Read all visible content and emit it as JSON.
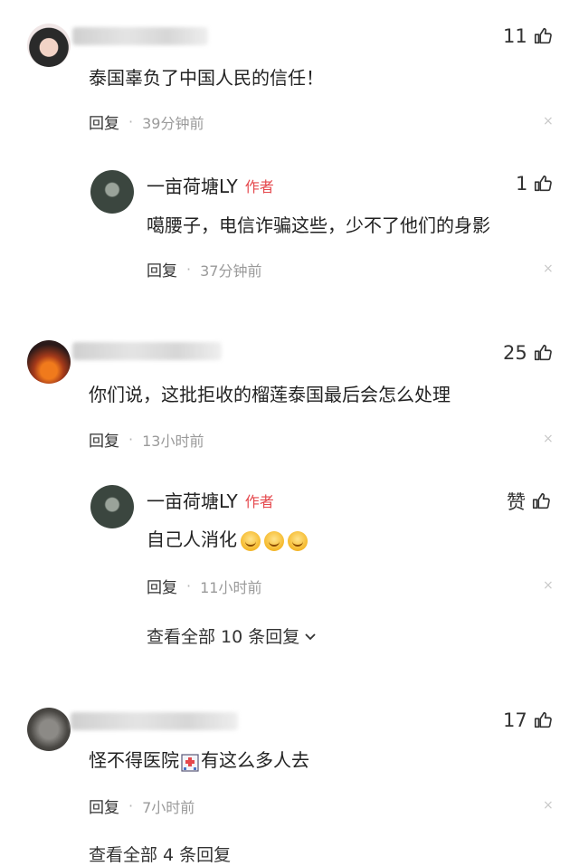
{
  "comments": [
    {
      "likes": "11",
      "text": "泰国辜负了中国人民的信任！",
      "reply_label": "回复",
      "time": "39分钟前",
      "replies": [
        {
          "name": "一亩荷塘LY",
          "tag": "作者",
          "likes": "1",
          "text": "噶腰子，电信诈骗这些，少不了他们的身影",
          "reply_label": "回复",
          "time": "37分钟前"
        }
      ]
    },
    {
      "likes": "25",
      "text": "你们说，这批拒收的榴莲泰国最后会怎么处理",
      "reply_label": "回复",
      "time": "13小时前",
      "replies": [
        {
          "name": "一亩荷塘LY",
          "tag": "作者",
          "likes": "赞",
          "text": "自己人消化",
          "reply_label": "回复",
          "time": "11小时前"
        }
      ],
      "view_all": "查看全部 10 条回复"
    },
    {
      "likes": "17",
      "text_before": "怪不得医院",
      "text_after": "有这么多人去",
      "reply_label": "回复",
      "time": "7小时前",
      "view_all": "查看全部 4 条回复"
    }
  ],
  "icons": {
    "like": "thumbs-up-icon",
    "close": "close-icon",
    "chevron": "chevron-down-icon",
    "hospital": "hospital-icon",
    "emoji": "smile-emoji"
  },
  "colors": {
    "author_tag": "#e5484d",
    "meta": "#9a9a9a"
  },
  "glyphs": {
    "close": "×",
    "separator": "·"
  }
}
